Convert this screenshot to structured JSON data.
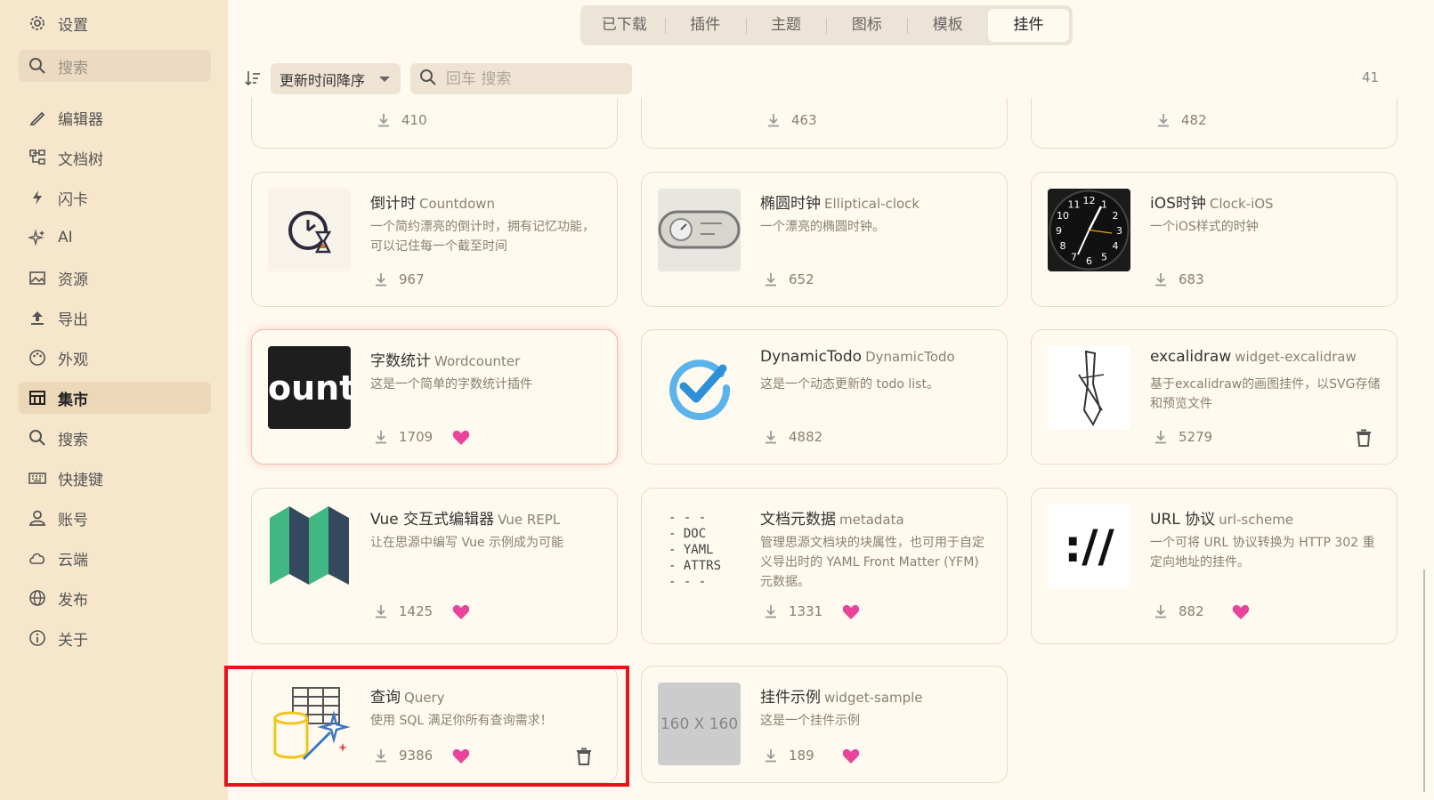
{
  "sidebar": {
    "settings": "设置",
    "search_placeholder": "搜索",
    "items": [
      {
        "label": "编辑器",
        "icon": "pencil-icon"
      },
      {
        "label": "文档树",
        "icon": "tree-icon"
      },
      {
        "label": "闪卡",
        "icon": "lightning-icon"
      },
      {
        "label": "AI",
        "icon": "sparkle-icon"
      },
      {
        "label": "资源",
        "icon": "image-icon"
      },
      {
        "label": "导出",
        "icon": "upload-icon"
      },
      {
        "label": "外观",
        "icon": "palette-icon"
      },
      {
        "label": "集市",
        "icon": "shop-icon",
        "active": true
      },
      {
        "label": "搜索",
        "icon": "search-icon"
      },
      {
        "label": "快捷键",
        "icon": "keyboard-icon"
      },
      {
        "label": "账号",
        "icon": "user-icon"
      },
      {
        "label": "云端",
        "icon": "cloud-icon"
      },
      {
        "label": "发布",
        "icon": "globe-icon"
      },
      {
        "label": "关于",
        "icon": "info-icon"
      }
    ]
  },
  "tabs": [
    "已下载",
    "插件",
    "主题",
    "图标",
    "模板",
    "挂件"
  ],
  "active_tab": "挂件",
  "toolbar": {
    "sort_label": "更新时间降序",
    "search_placeholder": "回车 搜索",
    "count": "41"
  },
  "partial_row": [
    "410",
    "463",
    "482"
  ],
  "cards": [
    {
      "title": "倒计时",
      "sub": "Countdown",
      "desc": "一个简约漂亮的倒计时，拥有记忆功能，可以记住每一个截至时间",
      "downloads": "967",
      "fav": false,
      "trash": false,
      "thumb_icon": "countdown-clock-icon"
    },
    {
      "title": "椭圆时钟",
      "sub": "Elliptical-clock",
      "desc": "一个漂亮的椭圆时钟。",
      "downloads": "652",
      "fav": false,
      "trash": false,
      "thumb_icon": "elliptical-clock-icon"
    },
    {
      "title": "iOS时钟",
      "sub": "Clock-iOS",
      "desc": "一个iOS样式的时钟",
      "downloads": "683",
      "fav": false,
      "trash": false,
      "thumb_icon": "ios-clock-icon"
    },
    {
      "title": "字数统计",
      "sub": "Wordcounter",
      "desc": "这是一个简单的字数统计插件",
      "downloads": "1709",
      "fav": true,
      "trash": false,
      "thumb_text": "ount",
      "thumb_icon": "wordcounter-thumbnail"
    },
    {
      "title": "DynamicTodo",
      "sub": "DynamicTodo",
      "desc": "这是一个动态更新的 todo list。",
      "downloads": "4882",
      "fav": false,
      "trash": false,
      "thumb_icon": "check-circle-icon"
    },
    {
      "title": "excalidraw",
      "sub": "widget-excalidraw",
      "desc": "基于excalidraw的画图挂件，以SVG存储和预览文件",
      "downloads": "5279",
      "fav": false,
      "trash": true,
      "thumb_icon": "excalidraw-pen-icon"
    },
    {
      "title": "Vue 交互式编辑器",
      "sub": "Vue REPL",
      "desc": "让在思源中编写 Vue 示例成为可能",
      "downloads": "1425",
      "fav": true,
      "trash": false,
      "thumb_icon": "vue-map-icon"
    },
    {
      "title": "文档元数据",
      "sub": "metadata",
      "desc": "管理思源文档块的块属性，也可用于自定义导出时的 YAML Front Matter (YFM) 元数据。",
      "downloads": "1331",
      "fav": true,
      "trash": false,
      "thumb_lines": [
        "- - -",
        "- DOC",
        "- YAML",
        "- ATTRS",
        "- - -"
      ],
      "thumb_icon": "metadata-thumbnail"
    },
    {
      "title": "URL 协议",
      "sub": "url-scheme",
      "desc": "一个可将 URL 协议转换为 HTTP 302 重定向地址的挂件。",
      "downloads": "882",
      "fav": true,
      "trash": false,
      "thumb_text": "://",
      "thumb_icon": "url-scheme-thumbnail"
    },
    {
      "title": "查询",
      "sub": "Query",
      "desc": "使用 SQL 满足你所有查询需求！",
      "downloads": "9386",
      "fav": true,
      "trash": true,
      "thumb_icon": "database-query-icon"
    },
    {
      "title": "挂件示例",
      "sub": "widget-sample",
      "desc": "这是一个挂件示例",
      "downloads": "189",
      "fav": true,
      "trash": false,
      "thumb_text": "160 X 160",
      "thumb_icon": "placeholder-thumbnail"
    }
  ],
  "colors": {
    "accent_heart": "#e8449a",
    "highlight_box": "#e8121d",
    "sidebar_bg": "#f6e6cc",
    "page_bg": "#fffaf0"
  }
}
